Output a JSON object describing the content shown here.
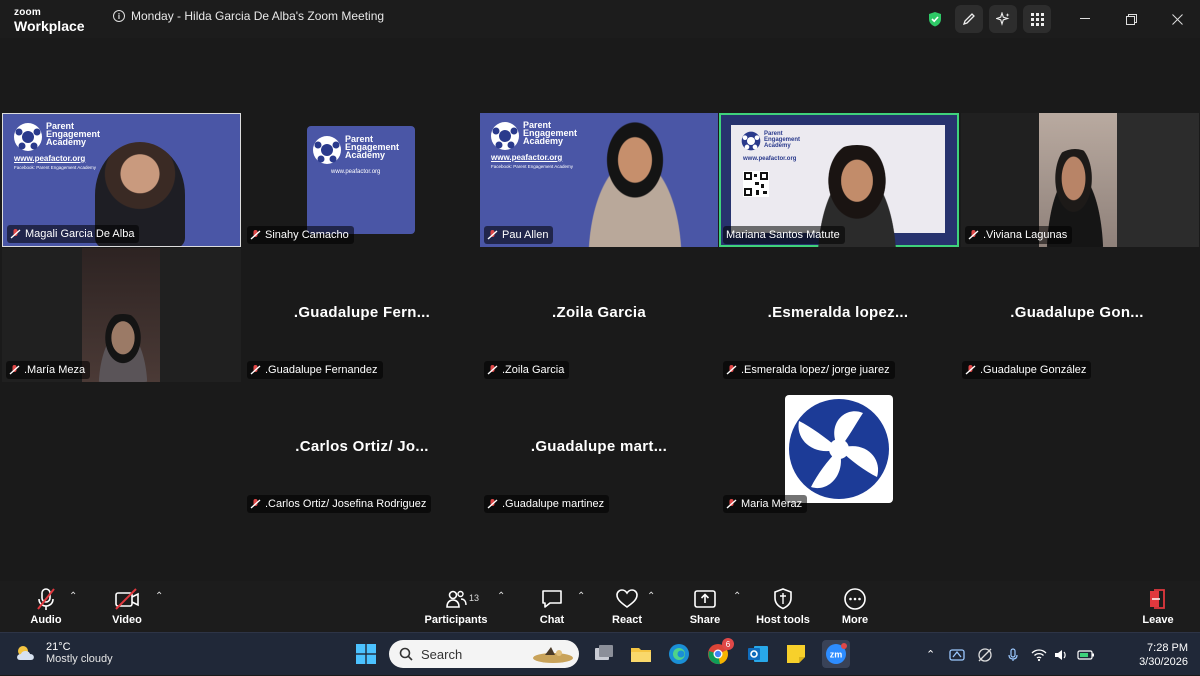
{
  "app": {
    "brand_line1": "zoom",
    "brand_line2": "Workplace"
  },
  "meeting": {
    "title": "Monday - Hilda Garcia De Alba's Zoom Meeting"
  },
  "slide": {
    "org_line1": "Parent",
    "org_line2": "Engagement",
    "org_line3": "Academy",
    "url": "www.peafactor.org",
    "facebook": "Facebook: Parent Engagement Academy"
  },
  "participants": [
    {
      "name": "Magali Garcia De Alba",
      "center": ""
    },
    {
      "name": "Sinahy Camacho",
      "center": ""
    },
    {
      "name": "Pau Allen",
      "center": ""
    },
    {
      "name": "Mariana Santos Matute",
      "center": ""
    },
    {
      "name": ".Viviana Lagunas",
      "center": ""
    },
    {
      "name": ".María Meza",
      "center": ""
    },
    {
      "name": ".Guadalupe Fernandez",
      "center": ".Guadalupe  Fern..."
    },
    {
      "name": ".Zoila Garcia",
      "center": ".Zoila Garcia"
    },
    {
      "name": ".Esmeralda lopez/ jorge juarez",
      "center": ".Esmeralda  lopez..."
    },
    {
      "name": ".Guadalupe González",
      "center": ".Guadalupe  Gon..."
    },
    {
      "name": ".Carlos Ortiz/ Josefina Rodriguez",
      "center": ".Carlos Ortiz/ Jo..."
    },
    {
      "name": ".Guadalupe martinez",
      "center": ".Guadalupe  mart..."
    },
    {
      "name": "Maria Meraz",
      "center": ""
    }
  ],
  "toolbar": {
    "audio": "Audio",
    "video": "Video",
    "participants": "Participants",
    "participants_count": "13",
    "chat": "Chat",
    "react": "React",
    "share": "Share",
    "host_tools": "Host tools",
    "more": "More",
    "leave": "Leave"
  },
  "taskbar": {
    "weather_temp": "21°C",
    "weather_desc": "Mostly cloudy",
    "search_placeholder": "Search",
    "time": "7:28 PM",
    "date": "3/30/2026",
    "chrome_badge": "6"
  },
  "colors": {
    "slide_blue": "#4a56a6",
    "active_border": "#3fd27b",
    "shield_green": "#2ec866",
    "leave_red": "#e0383e"
  }
}
